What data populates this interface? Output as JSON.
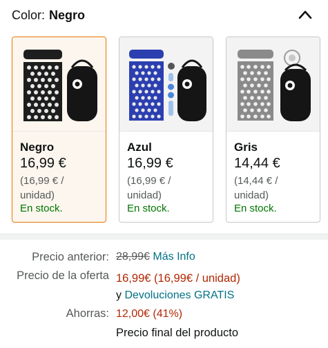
{
  "color_selector": {
    "label": "Color:",
    "selected": "Negro"
  },
  "variants": [
    {
      "name": "Negro",
      "price": "16,99 €",
      "unit_price": "(16,99 € / unidad)",
      "stock": "En stock.",
      "selected": true,
      "mat_color": "#1e1e1e"
    },
    {
      "name": "Azul",
      "price": "16,99 €",
      "unit_price": "(16,99 € / unidad)",
      "stock": "En stock.",
      "selected": false,
      "mat_color": "#2c3fb0"
    },
    {
      "name": "Gris",
      "price": "14,44 €",
      "unit_price": "(14,44 € / unidad)",
      "stock": "En stock.",
      "selected": false,
      "mat_color": "#8a8a8a"
    }
  ],
  "pricing": {
    "previous_label": "Precio anterior:",
    "previous_value": "28,99€",
    "more_info": "Más Info",
    "offer_label": "Precio de la oferta",
    "offer_value": "16,99€ (16,99€ / unidad)",
    "returns_prefix": "y",
    "returns_link": "Devoluciones GRATIS",
    "savings_label": "Ahorras:",
    "savings_value": "12,00€ (41%)",
    "final_note": "Precio final del producto"
  },
  "colors": {
    "accent_orange": "#e77600",
    "stock_green": "#007600",
    "price_red": "#b12704",
    "link_teal": "#007185"
  }
}
